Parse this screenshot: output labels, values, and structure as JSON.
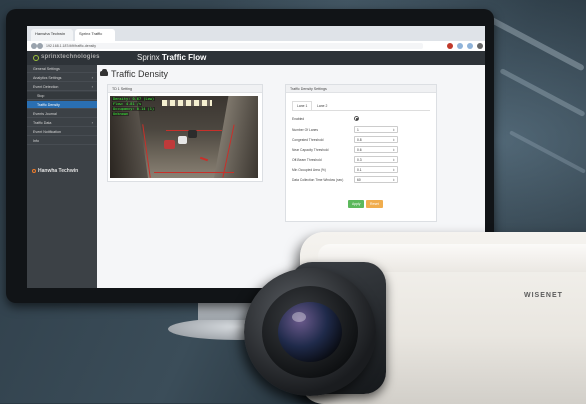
{
  "browser": {
    "tabs": [
      {
        "label": "Hanwha Techwin"
      },
      {
        "label": "Sprinx Traffic"
      }
    ],
    "url": "192.168.1.187/#/tf/traffic-density"
  },
  "header": {
    "company": "sprinxtechnologies",
    "product_prefix": "Sprinx",
    "product_name": "Traffic Flow"
  },
  "sidebar": {
    "items": [
      {
        "label": "General Settings"
      },
      {
        "label": "Analytics Settings"
      },
      {
        "label": "Event Detection"
      },
      {
        "label": "Stop"
      },
      {
        "label": "Traffic Density"
      },
      {
        "label": "Events Journal"
      },
      {
        "label": "Traffic Data"
      },
      {
        "label": "Event Notification"
      },
      {
        "label": "Info"
      }
    ],
    "brand": "Hanwha Techwin"
  },
  "page": {
    "title": "Traffic Density"
  },
  "video_panel": {
    "title": "TD 1 Setting",
    "osd_lines": [
      "Density: 0.67 (Low)",
      "Flow: 4.81 /s",
      "Occupancy: 0.14 (1)",
      "Unknown"
    ]
  },
  "settings_panel": {
    "title": "Traffic Density Settings",
    "tabs": [
      "Lane 1",
      "Lane 2"
    ],
    "fields": [
      {
        "label": "Enabled",
        "value": ""
      },
      {
        "label": "Number Of Lanes",
        "value": "1"
      },
      {
        "label": "Congested Threshold",
        "value": "0.8"
      },
      {
        "label": "Near Capacity Threshold",
        "value": "0.6"
      },
      {
        "label": "Off-Beam Threshold",
        "value": "0.3"
      },
      {
        "label": "Min Occupied Area (%)",
        "value": "0.1"
      },
      {
        "label": "Data Collection Time Window (sec)",
        "value": "60"
      }
    ],
    "apply_label": "Apply",
    "reset_label": "Reset"
  },
  "camera": {
    "brand": "WISENET"
  },
  "colors": {
    "accent": "#2a6fb2",
    "apply_button": "#5cb85c",
    "reset_button": "#f0ad4e",
    "osd_text": "#3aff3a"
  }
}
